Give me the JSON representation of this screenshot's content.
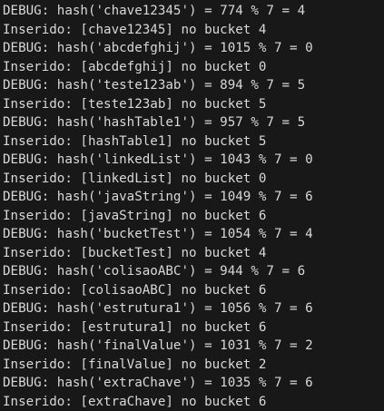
{
  "terminal": {
    "lines": [
      "DEBUG: hash('chave12345') = 774 % 7 = 4",
      "Inserido: [chave12345] no bucket 4",
      "DEBUG: hash('abcdefghij') = 1015 % 7 = 0",
      "Inserido: [abcdefghij] no bucket 0",
      "DEBUG: hash('teste123ab') = 894 % 7 = 5",
      "Inserido: [teste123ab] no bucket 5",
      "DEBUG: hash('hashTable1') = 957 % 7 = 5",
      "Inserido: [hashTable1] no bucket 5",
      "DEBUG: hash('linkedList') = 1043 % 7 = 0",
      "Inserido: [linkedList] no bucket 0",
      "DEBUG: hash('javaString') = 1049 % 7 = 6",
      "Inserido: [javaString] no bucket 6",
      "DEBUG: hash('bucketTest') = 1054 % 7 = 4",
      "Inserido: [bucketTest] no bucket 4",
      "DEBUG: hash('colisaoABC') = 944 % 7 = 6",
      "Inserido: [colisaoABC] no bucket 6",
      "DEBUG: hash('estrutura1') = 1056 % 7 = 6",
      "Inserido: [estrutura1] no bucket 6",
      "DEBUG: hash('finalValue') = 1031 % 7 = 2",
      "Inserido: [finalValue] no bucket 2",
      "DEBUG: hash('extraChave') = 1035 % 7 = 6",
      "Inserido: [extraChave] no bucket 6"
    ]
  }
}
